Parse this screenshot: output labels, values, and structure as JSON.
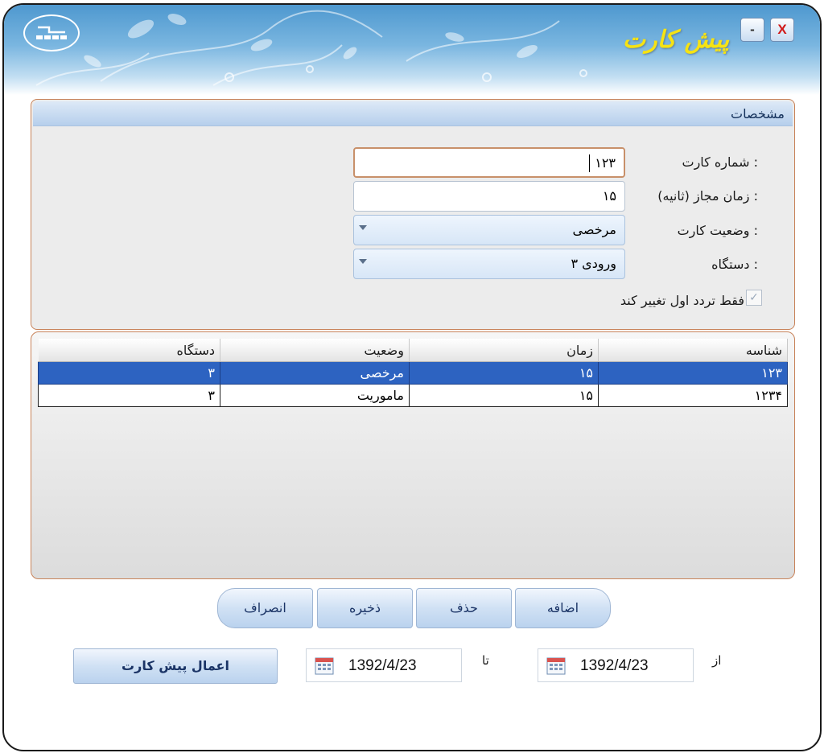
{
  "window": {
    "title": "پیش کارت",
    "minimize_label": "-",
    "close_label": "X"
  },
  "details_panel": {
    "title": "مشخصات",
    "card_number": {
      "label": "شماره کارت :",
      "value": "۱۲۳"
    },
    "allowed_time": {
      "label": "زمان مجاز (ثانیه) :",
      "value": "۱۵"
    },
    "card_status": {
      "label": "وضعیت کارت :",
      "value": "مرخصی"
    },
    "device": {
      "label": "دستگاه :",
      "value": "ورودی ۳"
    },
    "first_pass_only": {
      "label": "فقط تردد اول تغییر کند",
      "checked": true
    }
  },
  "table": {
    "columns": [
      "شناسه",
      "زمان",
      "وضعیت",
      "دستگاه"
    ],
    "rows": [
      {
        "id": "۱۲۳",
        "time": "۱۵",
        "status": "مرخصی",
        "device": "۳",
        "selected": true
      },
      {
        "id": "۱۲۳۴",
        "time": "۱۵",
        "status": "ماموریت",
        "device": "۳",
        "selected": false
      }
    ]
  },
  "actions": {
    "add": "اضافه",
    "delete": "حذف",
    "save": "ذخیره",
    "cancel": "انصراف"
  },
  "date_range": {
    "from_label": "از",
    "from_value": "1392/4/23",
    "to_label": "تا",
    "to_value": "1392/4/23",
    "apply_button": "اعمال پیش کارت"
  },
  "colors": {
    "header_blue": "#4e98cf",
    "selection_blue": "#2d63c1",
    "panel_border": "#c8835a",
    "title_yellow": "#f6e313",
    "close_red": "#d01818"
  }
}
